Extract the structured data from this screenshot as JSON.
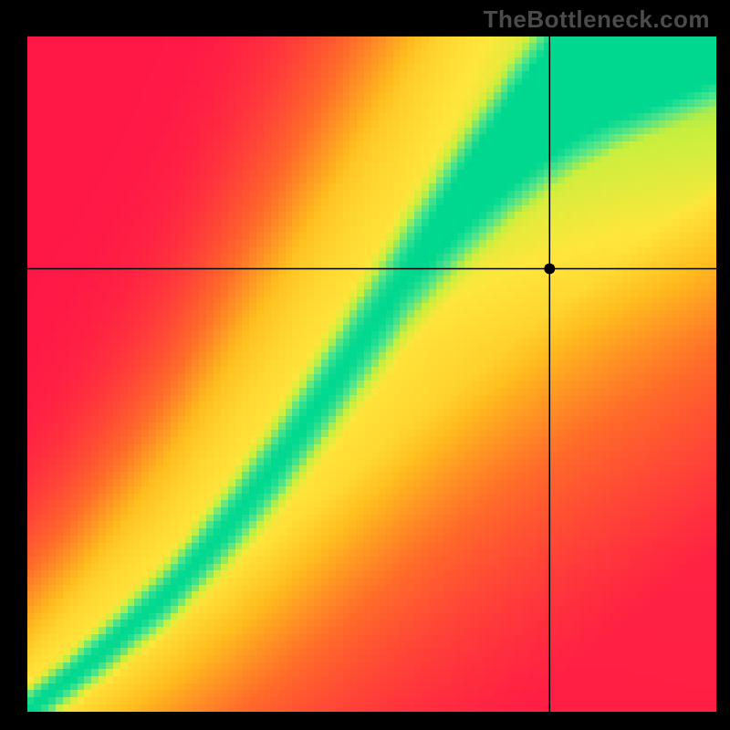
{
  "watermark": "TheBottleneck.com",
  "chart_data": {
    "type": "heatmap",
    "title": "",
    "xlabel": "",
    "ylabel": "",
    "xlim": [
      0,
      1
    ],
    "ylim": [
      0,
      1
    ],
    "marker": {
      "x": 0.758,
      "y": 0.656
    },
    "crosshair": {
      "x": 0.758,
      "y": 0.656
    },
    "ridge_points": [
      {
        "x": 0.0,
        "y": 0.0,
        "width": 0.02
      },
      {
        "x": 0.05,
        "y": 0.04,
        "width": 0.022
      },
      {
        "x": 0.1,
        "y": 0.08,
        "width": 0.025
      },
      {
        "x": 0.15,
        "y": 0.125,
        "width": 0.028
      },
      {
        "x": 0.2,
        "y": 0.17,
        "width": 0.032
      },
      {
        "x": 0.25,
        "y": 0.225,
        "width": 0.037
      },
      {
        "x": 0.3,
        "y": 0.285,
        "width": 0.043
      },
      {
        "x": 0.35,
        "y": 0.35,
        "width": 0.048
      },
      {
        "x": 0.4,
        "y": 0.42,
        "width": 0.053
      },
      {
        "x": 0.45,
        "y": 0.495,
        "width": 0.058
      },
      {
        "x": 0.5,
        "y": 0.57,
        "width": 0.063
      },
      {
        "x": 0.55,
        "y": 0.645,
        "width": 0.068
      },
      {
        "x": 0.6,
        "y": 0.715,
        "width": 0.072
      },
      {
        "x": 0.65,
        "y": 0.78,
        "width": 0.077
      },
      {
        "x": 0.7,
        "y": 0.84,
        "width": 0.082
      },
      {
        "x": 0.75,
        "y": 0.895,
        "width": 0.088
      },
      {
        "x": 0.8,
        "y": 0.945,
        "width": 0.093
      },
      {
        "x": 0.85,
        "y": 0.985,
        "width": 0.098
      },
      {
        "x": 0.9,
        "y": 1.015,
        "width": 0.103
      },
      {
        "x": 0.95,
        "y": 1.045,
        "width": 0.108
      },
      {
        "x": 1.0,
        "y": 1.075,
        "width": 0.112
      }
    ],
    "color_stops": [
      {
        "t": 0.0,
        "color": "#ff1846"
      },
      {
        "t": 0.35,
        "color": "#ff6a2a"
      },
      {
        "t": 0.6,
        "color": "#ffbd1e"
      },
      {
        "t": 0.78,
        "color": "#ffe63c"
      },
      {
        "t": 0.88,
        "color": "#c7ef3d"
      },
      {
        "t": 0.95,
        "color": "#4be38d"
      },
      {
        "t": 1.0,
        "color": "#00d890"
      }
    ],
    "grid_resolution": 96
  }
}
